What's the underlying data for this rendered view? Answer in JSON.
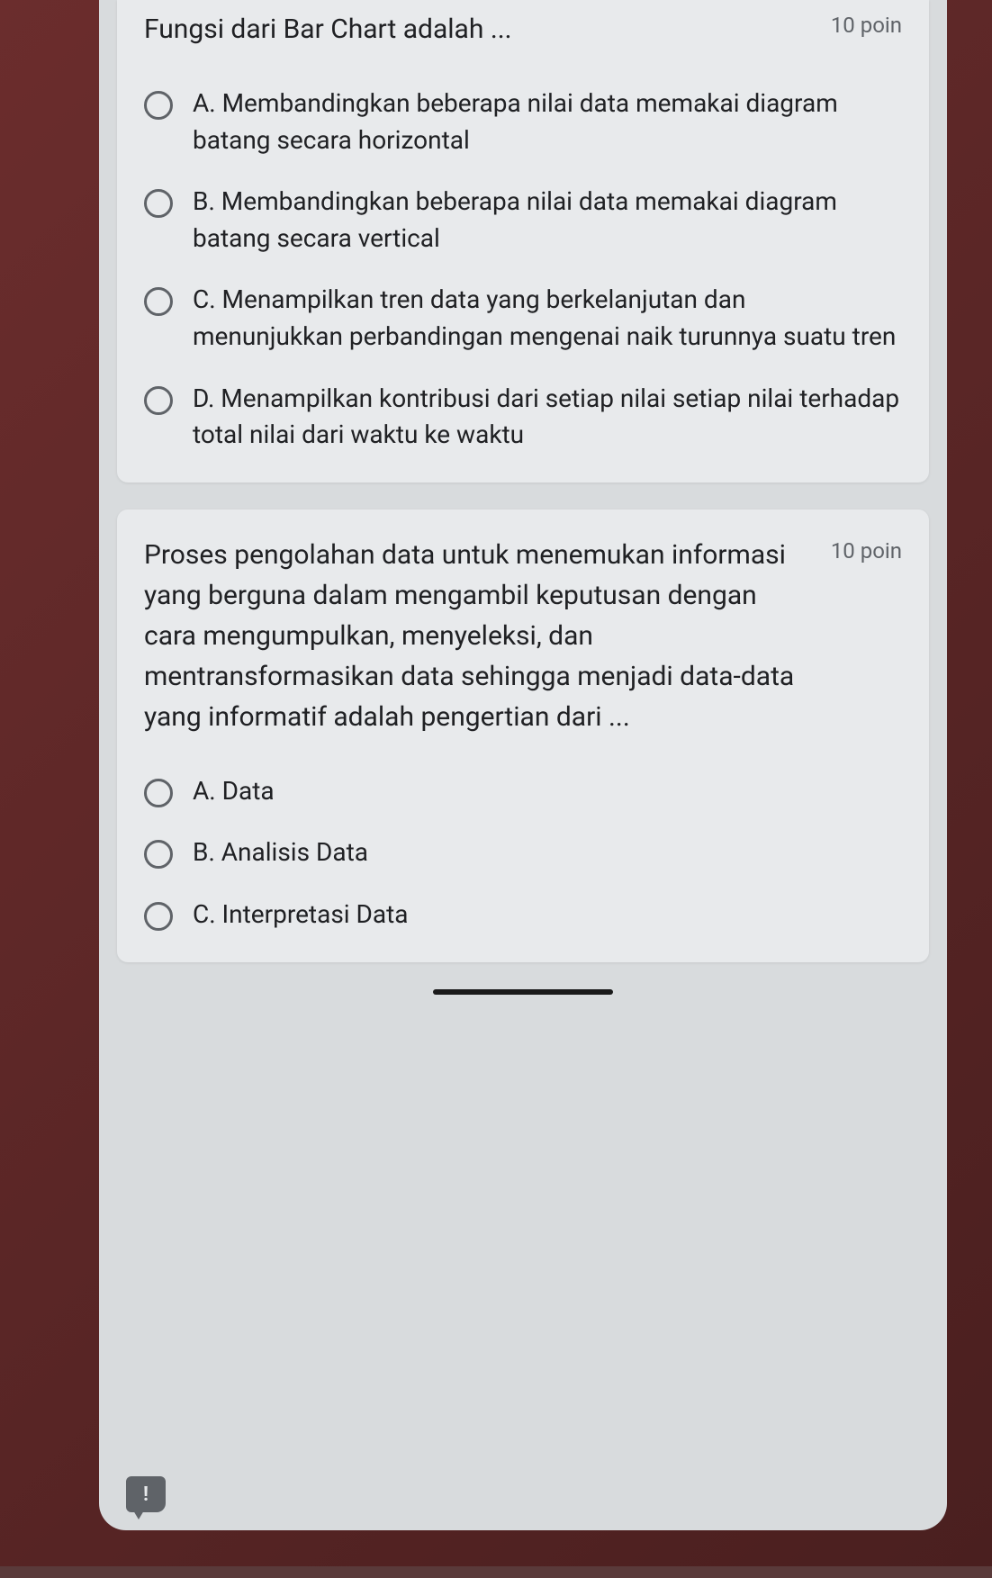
{
  "questions": [
    {
      "title": "Fungsi dari Bar Chart adalah ...",
      "points": "10 poin",
      "options": [
        "A. Membandingkan beberapa nilai data memakai diagram batang secara horizontal",
        "B. Membandingkan beberapa nilai data memakai diagram batang secara vertical",
        "C. Menampilkan tren data yang berkelanjutan dan menunjukkan perbandingan mengenai naik turunnya suatu tren",
        "D. Menampilkan kontribusi dari setiap nilai setiap nilai terhadap total nilai dari waktu ke waktu"
      ]
    },
    {
      "title": "Proses pengolahan data untuk menemukan informasi yang berguna dalam mengambil keputusan dengan cara mengumpulkan, menyeleksi, dan mentransformasikan data sehingga menjadi data-data yang informatif adalah pengertian dari ...",
      "points": "10 poin",
      "options": [
        "A. Data",
        "B. Analisis Data",
        "C. Interpretasi Data"
      ]
    }
  ]
}
